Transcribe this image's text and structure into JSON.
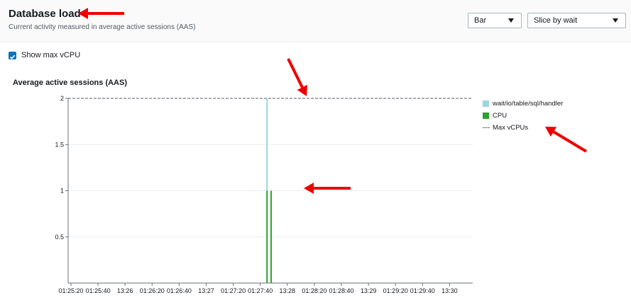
{
  "header": {
    "title": "Database load",
    "subtitle": "Current activity measured in average active sessions (AAS)",
    "view_select": "Bar",
    "slice_select": "Slice by wait"
  },
  "options": {
    "show_max_vcpu_label": "Show max vCPU",
    "show_max_vcpu_checked": true
  },
  "colors": {
    "wait_series": "#9ed5df",
    "cpu_series": "#2ea12e",
    "max_line": "#545b64",
    "annotation_arrow": "#ee0000"
  },
  "chart_data": {
    "type": "bar",
    "title": "Average active sessions (AAS)",
    "xlabel": "",
    "ylabel": "",
    "ylim": [
      0,
      2
    ],
    "yticks": [
      0.5,
      1,
      1.5,
      2
    ],
    "ytick_labels": [
      "0.5",
      "1",
      "1.5",
      "2"
    ],
    "xticks": [
      "01:25:20",
      "01:25:40",
      "13:26",
      "01:26:20",
      "01:26:40",
      "13:27",
      "01:27:20",
      "01:27:40",
      "13:28",
      "01:28:20",
      "01:28:40",
      "13:29",
      "01:29:20",
      "01:29:40",
      "13:30"
    ],
    "grid": true,
    "legend_position": "right",
    "max_vcpus": 2,
    "series": [
      {
        "name": "wait/io/table/sql/handler",
        "points": [
          {
            "time": "01:27:45",
            "value": 1
          }
        ]
      },
      {
        "name": "CPU",
        "points": [
          {
            "time": "01:27:45",
            "value": 1
          },
          {
            "time": "01:27:48",
            "value": 1
          }
        ]
      }
    ],
    "legend": [
      "wait/io/table/sql/handler",
      "CPU",
      "Max vCPUs"
    ]
  }
}
